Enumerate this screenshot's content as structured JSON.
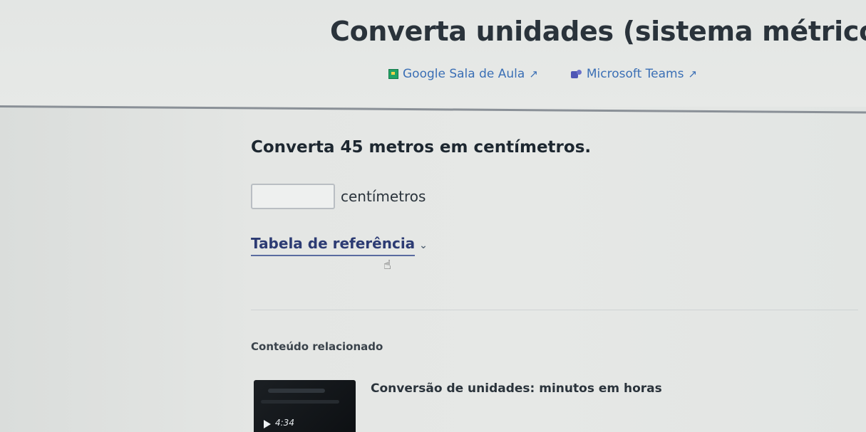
{
  "header": {
    "title": "Converta unidades (sistema métrico)",
    "integrations": [
      {
        "label": "Google Sala de Aula",
        "icon": "google-classroom-icon",
        "external_icon": "external-link-icon"
      },
      {
        "label": "Microsoft Teams",
        "icon": "microsoft-teams-icon",
        "external_icon": "external-link-icon"
      }
    ]
  },
  "exercise": {
    "question": "Converta 45 metros em centímetros.",
    "answer_value": "",
    "unit": "centímetros"
  },
  "reference": {
    "label": "Tabela de referência",
    "icon": "chevron-down-icon"
  },
  "related": {
    "heading": "Conteúdo relacionado",
    "items": [
      {
        "title": "Conversão de unidades: minutos em horas",
        "duration": "4:34",
        "icon": "play-icon"
      }
    ]
  },
  "colors": {
    "link": "#3b6fb5",
    "reference_link": "#2c3b73",
    "classroom_green": "#21a366",
    "teams_purple": "#4f56b5"
  }
}
